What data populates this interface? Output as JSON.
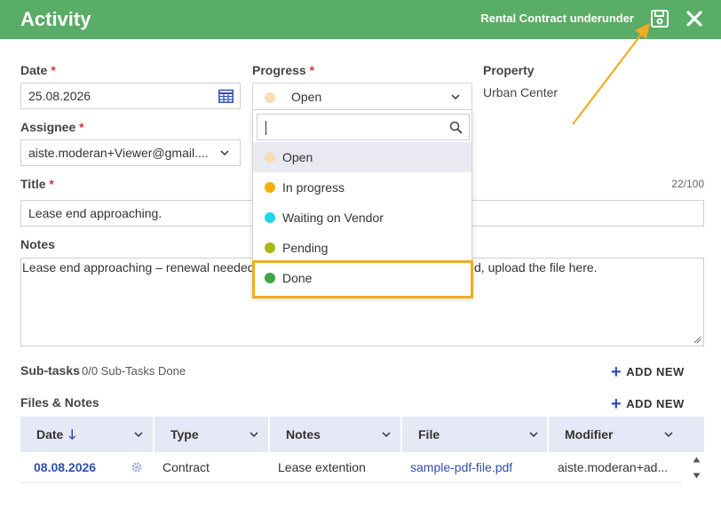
{
  "header": {
    "title": "Activity",
    "context_prefix": "Rental Contract",
    "context_name": "underunder"
  },
  "form": {
    "date": {
      "label": "Date",
      "required": "*",
      "value": "25.08.2026"
    },
    "progress": {
      "label": "Progress",
      "required": "*",
      "value": "Open",
      "dot_color": "#f7dcb4"
    },
    "property": {
      "label": "Property",
      "value": "Urban Center"
    },
    "assignee": {
      "label": "Assignee",
      "required": "*",
      "value": "aiste.moderan+Viewer@gmail...."
    },
    "title": {
      "label": "Title",
      "required": "*",
      "value": "Lease end approaching.",
      "counter": "22/100"
    },
    "notes": {
      "label": "Notes",
      "value_left": "Lease end approaching – renewal needed.",
      "value_right": "d, upload the file here."
    }
  },
  "progress_dropdown": {
    "search_value": "",
    "options": [
      {
        "label": "Open",
        "color": "#f7dcb4",
        "selected": true
      },
      {
        "label": "In progress",
        "color": "#f2b100"
      },
      {
        "label": "Waiting on Vendor",
        "color": "#1fd7e4"
      },
      {
        "label": "Pending",
        "color": "#a8b816"
      },
      {
        "label": "Done",
        "color": "#3aa845",
        "highlighted": true
      }
    ]
  },
  "subtasks": {
    "label": "Sub-tasks",
    "count": "0/0 Sub-Tasks Done",
    "add_label": "ADD NEW"
  },
  "files": {
    "label": "Files & Notes",
    "add_label": "ADD NEW",
    "columns": [
      "Date",
      "Type",
      "Notes",
      "File",
      "Modifier"
    ],
    "rows": [
      {
        "date": "08.08.2026",
        "type": "Contract",
        "notes": "Lease extention",
        "file": "sample-pdf-file.pdf",
        "modifier": "aiste.moderan+ad..."
      }
    ]
  },
  "colors": {
    "header_bg": "#5aad66",
    "accent_blue": "#2f4fb0",
    "required_red": "#e03131",
    "highlight_orange": "#f0ac24"
  }
}
